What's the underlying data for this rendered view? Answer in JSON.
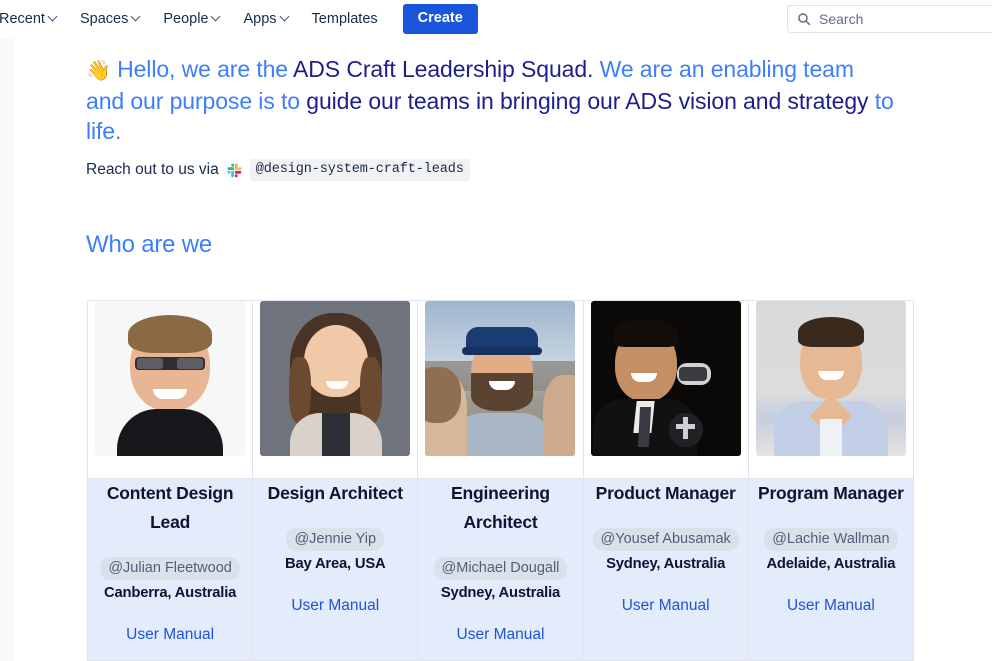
{
  "navbar": {
    "items": [
      {
        "label": "Recent",
        "has_caret": true,
        "name": "nav-recent"
      },
      {
        "label": "Spaces",
        "has_caret": true,
        "name": "nav-spaces"
      },
      {
        "label": "People",
        "has_caret": true,
        "name": "nav-people"
      },
      {
        "label": "Apps",
        "has_caret": true,
        "name": "nav-apps"
      },
      {
        "label": "Templates",
        "has_caret": false,
        "name": "nav-templates"
      }
    ],
    "create_label": "Create",
    "create_color": "#1a56db",
    "search_placeholder": "Search"
  },
  "intro": {
    "emoji": "👋",
    "seg1": "Hello, we are the ",
    "seg2": "ADS Craft Leadership Squad.",
    "seg3": " We are an enabling team and our purpose is to ",
    "seg4": "guide our teams in bringing our ADS vision and strategy",
    "seg5": " to life.",
    "color_light": "#3d7eff",
    "color_dark": "#1b1f8a"
  },
  "contact": {
    "prefix": "Reach out to us via",
    "channel": "@design-system-craft-leads",
    "icon": "slack-icon"
  },
  "section": {
    "title": "Who are we"
  },
  "team": [
    {
      "role": "Content Design Lead",
      "mention": "@Julian Fleetwood",
      "location": "Canberra, Australia",
      "link": "User Manual",
      "photo": "portrait-julian"
    },
    {
      "role": "Design Architect",
      "mention": "@Jennie Yip",
      "location": "Bay Area, USA",
      "link": "User Manual",
      "photo": "portrait-jennie"
    },
    {
      "role": "Engineering Architect",
      "mention": "@Michael Dougall",
      "location": "Sydney, Australia",
      "link": "User Manual",
      "photo": "portrait-michael"
    },
    {
      "role": "Product Manager",
      "mention": "@Yousef Abusamak",
      "location": "Sydney, Australia",
      "link": "User Manual",
      "photo": "portrait-yousef"
    },
    {
      "role": "Program Manager",
      "mention": "@Lachie Wallman",
      "location": "Adelaide, Australia",
      "link": "User Manual",
      "photo": "portrait-lachie"
    }
  ]
}
